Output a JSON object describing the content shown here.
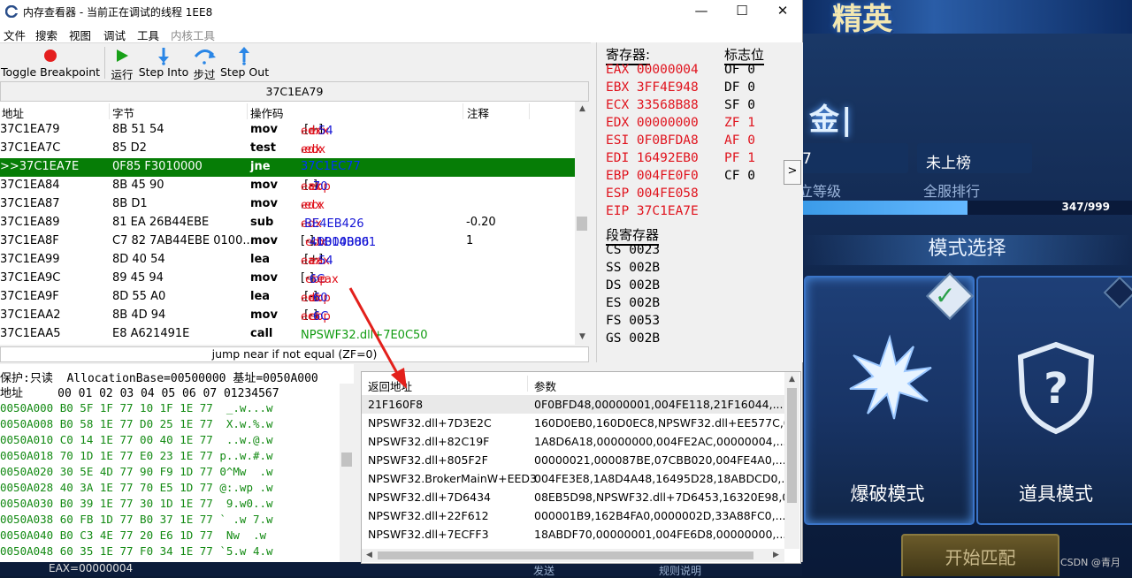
{
  "window": {
    "title": "内存查看器 - 当前正在调试的线程 1EE8",
    "controls": [
      "—",
      "☐",
      "✕"
    ]
  },
  "menu": [
    "文件",
    "搜索",
    "视图",
    "调试",
    "工具",
    "内核工具"
  ],
  "toolbar": [
    {
      "label": "Toggle Breakpoint",
      "icon": "breakpoint-icon"
    },
    {
      "label": "运行",
      "icon": "run-icon"
    },
    {
      "label": "Step Into",
      "icon": "step-into-icon"
    },
    {
      "label": "步过",
      "icon": "step-over-icon"
    },
    {
      "label": "Step Out",
      "icon": "step-out-icon"
    }
  ],
  "disassembler": {
    "current_address": "37C1EA79",
    "columns": [
      "地址",
      "字节",
      "操作码",
      "注释"
    ],
    "rows": [
      {
        "addr": "37C1EA79",
        "bytes": "8B 51 54",
        "op": "mov",
        "operand_html": "<span class='r'>edx</span>,[<span class='r'>ecx</span>+<span class='bl'>54</span>]",
        "comment": ""
      },
      {
        "addr": "37C1EA7C",
        "bytes": "85 D2",
        "op": "test",
        "operand_html": "<span class='r'>edx</span>,<span class='r'>edx</span>",
        "comment": ""
      },
      {
        "addr": ">>37C1EA7E",
        "bytes": "0F85 F3010000",
        "op": "jne",
        "operand_html": "37C1EC77",
        "comment": "",
        "selected": true
      },
      {
        "addr": "37C1EA84",
        "bytes": "8B 45 90",
        "op": "mov",
        "operand_html": "<span class='r'>eax</span>,[<span class='r'>ebp</span>-<span class='bl'>70</span>]",
        "comment": ""
      },
      {
        "addr": "37C1EA87",
        "bytes": "8B D1",
        "op": "mov",
        "operand_html": "<span class='r'>edx</span>,<span class='r'>ecx</span>",
        "comment": ""
      },
      {
        "addr": "37C1EA89",
        "bytes": "81 EA 26B44EBE",
        "op": "sub",
        "operand_html": "<span class='r'>edx</span>,<span class='bl'>BE4EB426</span>",
        "comment": "-0.20"
      },
      {
        "addr": "37C1EA8F",
        "bytes": "C7 82 7AB44EBE 0100...",
        "op": "mov",
        "operand_html": "[<span class='r'>edx</span>-<span class='bl'>41B14B86</span>],<span class='bl'>00000001</span>",
        "comment": "1"
      },
      {
        "addr": "37C1EA99",
        "bytes": "8D 40 54",
        "op": "lea",
        "operand_html": "<span class='r'>eax</span>,[<span class='r'>eax</span>+<span class='bl'>54</span>]",
        "comment": ""
      },
      {
        "addr": "37C1EA9C",
        "bytes": "89 45 94",
        "op": "mov",
        "operand_html": "[<span class='r'>ebp</span>-<span class='bl'>6C</span>],<span class='r'>eax</span>",
        "comment": ""
      },
      {
        "addr": "37C1EA9F",
        "bytes": "8D 55 A0",
        "op": "lea",
        "operand_html": "<span class='r'>edx</span>,[<span class='r'>ebp</span>-<span class='bl'>60</span>]",
        "comment": ""
      },
      {
        "addr": "37C1EAA2",
        "bytes": "8B 4D 94",
        "op": "mov",
        "operand_html": "<span class='r'>ecx</span>,[<span class='r'>ebp</span>-<span class='bl'>6C</span>]",
        "comment": ""
      },
      {
        "addr": "37C1EAA5",
        "bytes": "E8 A621491E",
        "op": "call",
        "operand_html": "<span class='g'>NPSWF32.dll+7E0C50</span>",
        "comment": ""
      }
    ],
    "status": "jump near if not equal (ZF=0)"
  },
  "registers": {
    "header": "寄存器:",
    "items": [
      {
        "name": "EAX",
        "value": "00000004"
      },
      {
        "name": "EBX",
        "value": "3FF4E948"
      },
      {
        "name": "ECX",
        "value": "33568B88"
      },
      {
        "name": "EDX",
        "value": "00000000"
      },
      {
        "name": "ESI",
        "value": "0F0BFDA8"
      },
      {
        "name": "EDI",
        "value": "16492EB0"
      },
      {
        "name": "EBP",
        "value": "004FE0F0"
      },
      {
        "name": "ESP",
        "value": "004FE058"
      },
      {
        "name": "EIP",
        "value": "37C1EA7E"
      }
    ],
    "segment_header": "段寄存器",
    "segments": [
      {
        "name": "CS",
        "value": "0023"
      },
      {
        "name": "SS",
        "value": "002B"
      },
      {
        "name": "DS",
        "value": "002B"
      },
      {
        "name": "ES",
        "value": "002B"
      },
      {
        "name": "FS",
        "value": "0053"
      },
      {
        "name": "GS",
        "value": "002B"
      }
    ],
    "flags_header": "标志位",
    "flags": [
      {
        "name": "OF",
        "value": "0",
        "changed": false
      },
      {
        "name": "DF",
        "value": "0",
        "changed": false
      },
      {
        "name": "SF",
        "value": "0",
        "changed": false
      },
      {
        "name": "ZF",
        "value": "1",
        "changed": true
      },
      {
        "name": "AF",
        "value": "0",
        "changed": true
      },
      {
        "name": "PF",
        "value": "1",
        "changed": true
      },
      {
        "name": "CF",
        "value": "0",
        "changed": false
      }
    ],
    "expand_label": ">"
  },
  "hexdump": {
    "protection": "保护:只读  AllocationBase=00500000 基址=0050A000",
    "header": "地址     00 01 02 03 04 05 06 07 01234567",
    "rows": [
      "0050A000 B0 5F 1F 77 10 1F 1E 77  _.w...w",
      "0050A008 B0 58 1E 77 D0 25 1E 77  X.w.%.w",
      "0050A010 C0 14 1E 77 00 40 1E 77  ..w.@.w",
      "0050A018 70 1D 1E 77 E0 23 1E 77 p..w.#.w",
      "0050A020 30 5E 4D 77 90 F9 1D 77 0^Mw  .w",
      "0050A028 40 3A 1E 77 70 E5 1D 77 @:.wp .w",
      "0050A030 B0 39 1E 77 30 1D 1E 77  9.w0..w",
      "0050A038 60 FB 1D 77 B0 37 1E 77 ` .w 7.w",
      "0050A040 B0 C3 4E 77 20 E6 1D 77  Nw  .w",
      "0050A048 60 35 1E 77 F0 34 1E 77 `5.w 4.w"
    ]
  },
  "callstack": {
    "columns": [
      "返回地址",
      "参数"
    ],
    "rows": [
      {
        "ret": "21F160F8",
        "params": "0F0BFD48,00000001,004FE118,21F16044,..."
      },
      {
        "ret": "NPSWF32.dll+7D3E2C",
        "params": "160D0EB0,160D0EC8,NPSWF32.dll+EE577C,004F..."
      },
      {
        "ret": "NPSWF32.dll+82C19F",
        "params": "1A8D6A18,00000000,004FE2AC,00000004,..."
      },
      {
        "ret": "NPSWF32.dll+805F2F",
        "params": "00000021,000087BE,07CBB020,004FE4A0,..."
      },
      {
        "ret": "NPSWF32.BrokerMainW+EED3",
        "params": "004FE3E8,1A8D4A48,16495D28,18ABDCD0,..."
      },
      {
        "ret": "NPSWF32.dll+7D6434",
        "params": "08EB5D98,NPSWF32.dll+7D6453,16320E98,079E..."
      },
      {
        "ret": "NPSWF32.dll+22F612",
        "params": "000001B9,162B4FA0,0000002D,33A88FC0,..."
      },
      {
        "ret": "NPSWF32.dll+7ECFF3",
        "params": "18ABDF70,00000001,004FE6D8,00000000,..."
      }
    ]
  },
  "bottom": {
    "eax": "EAX=00000004",
    "send": "发送",
    "rules": "规则说明"
  },
  "game": {
    "banner": "精英",
    "jin": "金|",
    "stat1": "7",
    "stat1_label": "立等级",
    "stat2": "未上榜",
    "stat2_label": "全服排行",
    "progress_text": "347/999",
    "progress_fraction": 0.5,
    "mode_title": "模式选择",
    "mode1": "爆破模式",
    "mode2": "道具模式",
    "start": "开始匹配",
    "watermark": "CSDN @青月"
  }
}
